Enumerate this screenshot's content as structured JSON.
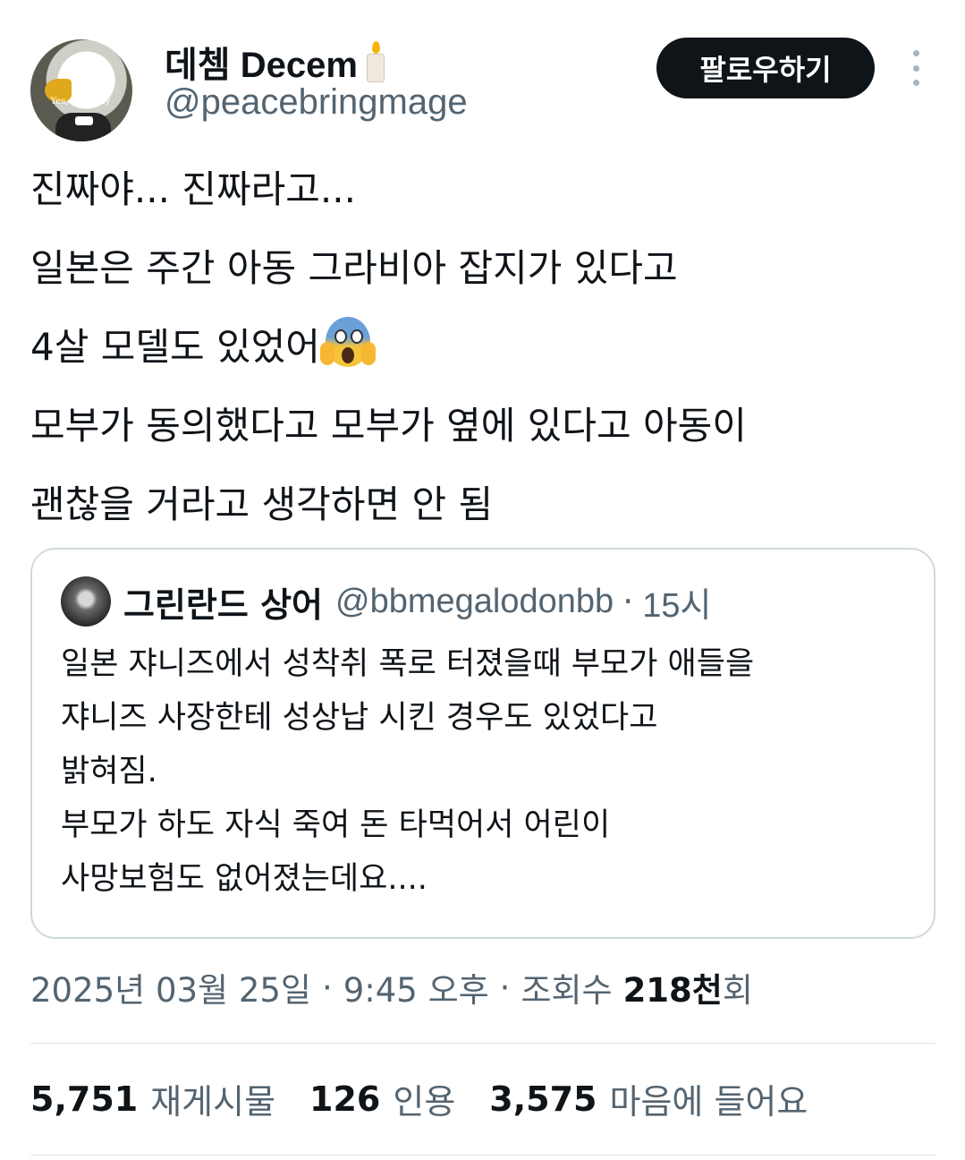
{
  "author": {
    "display_name": "데쳄 Decem",
    "name_emoji": "candle-icon",
    "handle": "@peacebringmage",
    "avatar_caption": "Yes, My Lady"
  },
  "follow_button": {
    "label": "팔로우하기"
  },
  "more_icon": "vertical-ellipsis-icon",
  "tweet": {
    "lines": [
      "진짜야... 진짜라고...",
      "일본은 주간 아동 그라비아 잡지가 있다고",
      "4살 모델도 있었어",
      "모부가 동의했다고 모부가 옆에 있다고 아동이",
      "괜찮을 거라고 생각하면 안 됨"
    ],
    "emoji": "face-screaming-in-fear-icon"
  },
  "quoted_tweet": {
    "display_name": "그린란드 상어",
    "handle": "@bbmegalodonbb",
    "separator": "·",
    "time": "15시",
    "lines": [
      "일본 쟈니즈에서 성착취 폭로 터졌을때 부모가 애들을",
      "쟈니즈 사장한테 성상납 시킨 경우도 있었다고",
      "밝혀짐.",
      "부모가 하도 자식 죽여 돈 타먹어서 어린이",
      "사망보험도 없어졌는데요...."
    ]
  },
  "meta": {
    "date": "2025년 03월 25일",
    "separator": "·",
    "time": "9:45 오후",
    "views_label_prefix": "조회수",
    "views_count": "218천",
    "views_label_suffix": "회"
  },
  "stats": {
    "reposts": {
      "count": "5,751",
      "label": "재게시물"
    },
    "quotes": {
      "count": "126",
      "label": "인용"
    },
    "likes": {
      "count": "3,575",
      "label": "마음에 들어요"
    }
  },
  "colors": {
    "text_primary": "#0f1419",
    "text_secondary": "#536471",
    "border": "#cfd9de",
    "button_bg": "#0f1419"
  }
}
